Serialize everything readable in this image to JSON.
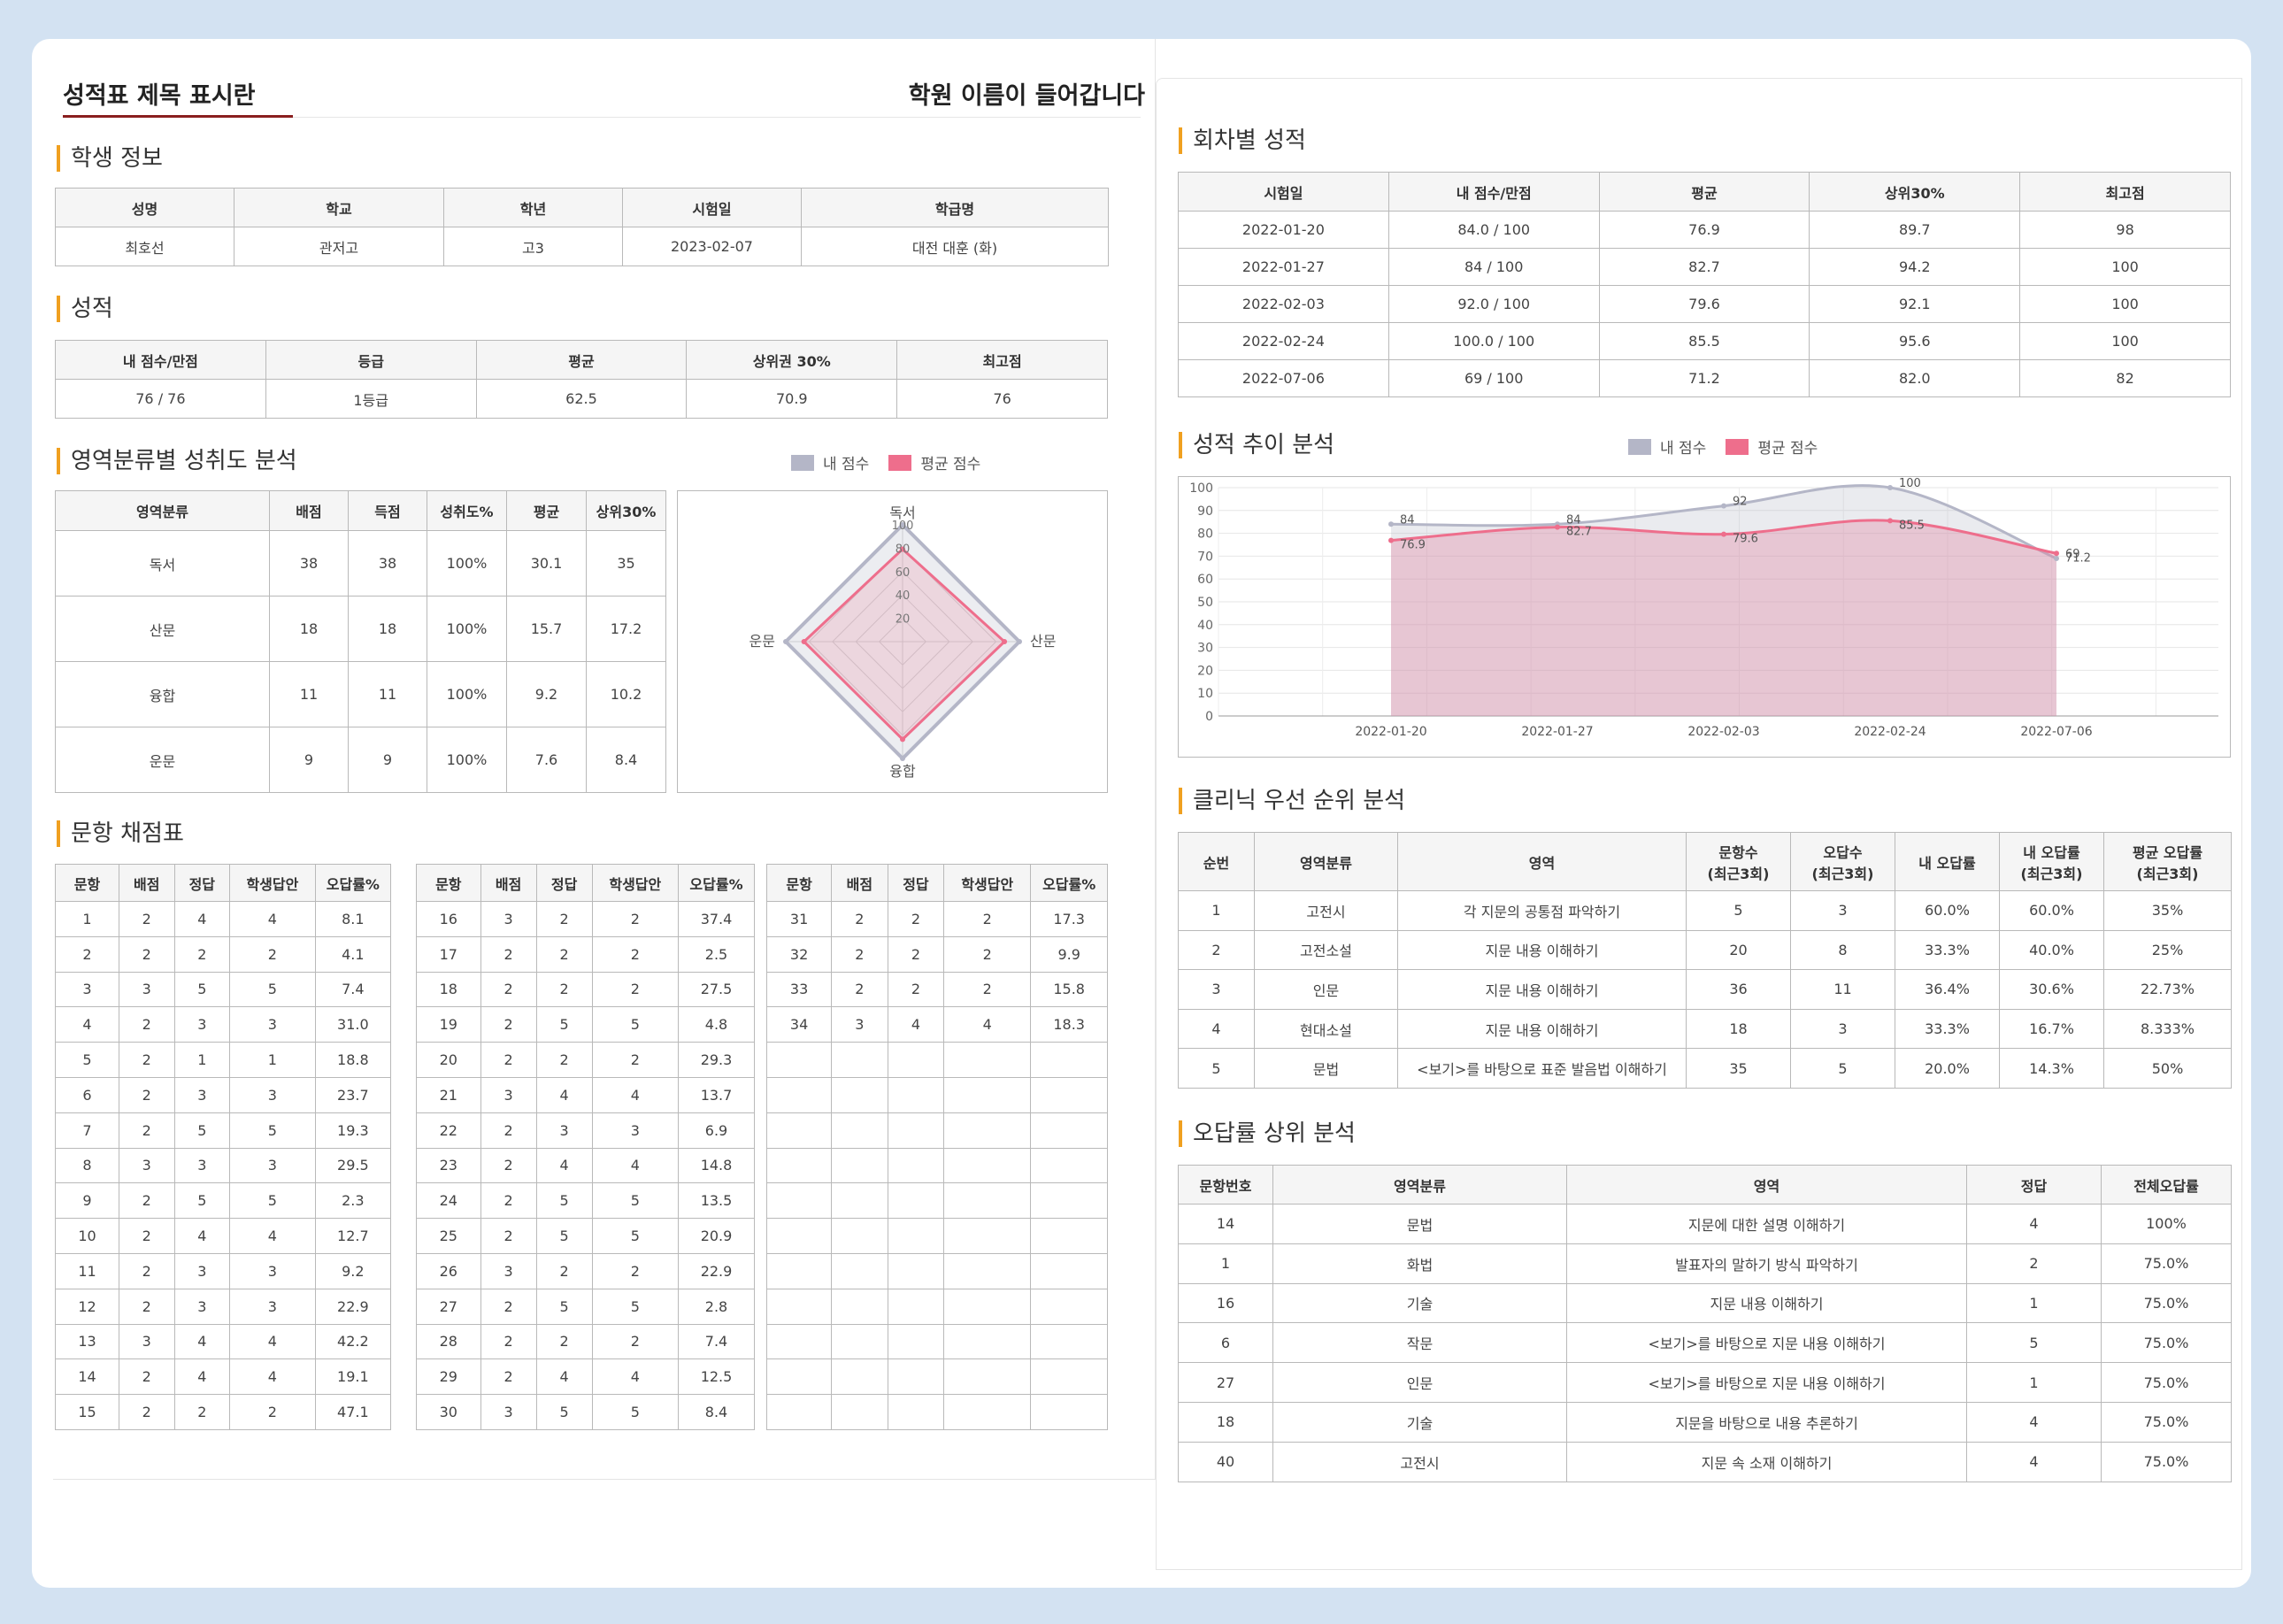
{
  "title": "성적표 제목 표시란",
  "academy": "학원 이름이 들어갑니다",
  "colors": {
    "accent": "#f0a020",
    "title_underline": "#8a1f1f",
    "my_score": "#b4b6c7",
    "avg_score": "#ee6e8c",
    "background": "#d3e2f2"
  },
  "student": {
    "section": "학생 정보",
    "headers": [
      "성명",
      "학교",
      "학년",
      "시험일",
      "학급명"
    ],
    "values": [
      "최호선",
      "관저고",
      "고3",
      "2023-02-07",
      "대전 대훈 (화)"
    ]
  },
  "score": {
    "section": "성적",
    "headers": [
      "내 점수/만점",
      "등급",
      "평균",
      "상위권 30%",
      "최고점"
    ],
    "values": [
      "76 / 76",
      "1등급",
      "62.5",
      "70.9",
      "76"
    ]
  },
  "area": {
    "section": "영역분류별 성취도 분석",
    "legend": [
      "내 점수",
      "평균 점수"
    ],
    "headers": [
      "영역분류",
      "배점",
      "득점",
      "성취도%",
      "평균",
      "상위30%"
    ],
    "rows": [
      [
        "독서",
        "38",
        "38",
        "100%",
        "30.1",
        "35"
      ],
      [
        "산문",
        "18",
        "18",
        "100%",
        "15.7",
        "17.2"
      ],
      [
        "융합",
        "11",
        "11",
        "100%",
        "9.2",
        "10.2"
      ],
      [
        "운문",
        "9",
        "9",
        "100%",
        "7.6",
        "8.4"
      ]
    ]
  },
  "radar": {
    "axes": [
      "독서",
      "산문",
      "융합",
      "운문"
    ],
    "ticks": [
      "20",
      "40",
      "60",
      "80",
      "100"
    ],
    "max": 100,
    "my": [
      100,
      100,
      100,
      100
    ],
    "avg": [
      79.2,
      87.2,
      83.6,
      84.4
    ]
  },
  "grading": {
    "section": "문항 채점표",
    "headers": [
      "문항",
      "배점",
      "정답",
      "학생답안",
      "오답률%"
    ],
    "blocks": [
      [
        [
          "1",
          "2",
          "4",
          "4",
          "8.1"
        ],
        [
          "2",
          "2",
          "2",
          "2",
          "4.1"
        ],
        [
          "3",
          "3",
          "5",
          "5",
          "7.4"
        ],
        [
          "4",
          "2",
          "3",
          "3",
          "31.0"
        ],
        [
          "5",
          "2",
          "1",
          "1",
          "18.8"
        ],
        [
          "6",
          "2",
          "3",
          "3",
          "23.7"
        ],
        [
          "7",
          "2",
          "5",
          "5",
          "19.3"
        ],
        [
          "8",
          "3",
          "3",
          "3",
          "29.5"
        ],
        [
          "9",
          "2",
          "5",
          "5",
          "2.3"
        ],
        [
          "10",
          "2",
          "4",
          "4",
          "12.7"
        ],
        [
          "11",
          "2",
          "3",
          "3",
          "9.2"
        ],
        [
          "12",
          "2",
          "3",
          "3",
          "22.9"
        ],
        [
          "13",
          "3",
          "4",
          "4",
          "42.2"
        ],
        [
          "14",
          "2",
          "4",
          "4",
          "19.1"
        ],
        [
          "15",
          "2",
          "2",
          "2",
          "47.1"
        ]
      ],
      [
        [
          "16",
          "3",
          "2",
          "2",
          "37.4"
        ],
        [
          "17",
          "2",
          "2",
          "2",
          "2.5"
        ],
        [
          "18",
          "2",
          "2",
          "2",
          "27.5"
        ],
        [
          "19",
          "2",
          "5",
          "5",
          "4.8"
        ],
        [
          "20",
          "2",
          "2",
          "2",
          "29.3"
        ],
        [
          "21",
          "3",
          "4",
          "4",
          "13.7"
        ],
        [
          "22",
          "2",
          "3",
          "3",
          "6.9"
        ],
        [
          "23",
          "2",
          "4",
          "4",
          "14.8"
        ],
        [
          "24",
          "2",
          "5",
          "5",
          "13.5"
        ],
        [
          "25",
          "2",
          "5",
          "5",
          "20.9"
        ],
        [
          "26",
          "3",
          "2",
          "2",
          "22.9"
        ],
        [
          "27",
          "2",
          "5",
          "5",
          "2.8"
        ],
        [
          "28",
          "2",
          "2",
          "2",
          "7.4"
        ],
        [
          "29",
          "2",
          "4",
          "4",
          "12.5"
        ],
        [
          "30",
          "3",
          "5",
          "5",
          "8.4"
        ]
      ],
      [
        [
          "31",
          "2",
          "2",
          "2",
          "17.3"
        ],
        [
          "32",
          "2",
          "2",
          "2",
          "9.9"
        ],
        [
          "33",
          "2",
          "2",
          "2",
          "15.8"
        ],
        [
          "34",
          "3",
          "4",
          "4",
          "18.3"
        ],
        [
          "",
          "",
          "",
          "",
          ""
        ],
        [
          "",
          "",
          "",
          "",
          ""
        ],
        [
          "",
          "",
          "",
          "",
          ""
        ],
        [
          "",
          "",
          "",
          "",
          ""
        ],
        [
          "",
          "",
          "",
          "",
          ""
        ],
        [
          "",
          "",
          "",
          "",
          ""
        ],
        [
          "",
          "",
          "",
          "",
          ""
        ],
        [
          "",
          "",
          "",
          "",
          ""
        ],
        [
          "",
          "",
          "",
          "",
          ""
        ],
        [
          "",
          "",
          "",
          "",
          ""
        ],
        [
          "",
          "",
          "",
          "",
          ""
        ]
      ]
    ]
  },
  "rounds": {
    "section": "회차별 성적",
    "headers": [
      "시험일",
      "내 점수/만점",
      "평균",
      "상위30%",
      "최고점"
    ],
    "rows": [
      [
        "2022-01-20",
        "84.0 / 100",
        "76.9",
        "89.7",
        "98"
      ],
      [
        "2022-01-27",
        "84 / 100",
        "82.7",
        "94.2",
        "100"
      ],
      [
        "2022-02-03",
        "92.0 / 100",
        "79.6",
        "92.1",
        "100"
      ],
      [
        "2022-02-24",
        "100.0 / 100",
        "85.5",
        "95.6",
        "100"
      ],
      [
        "2022-07-06",
        "69 / 100",
        "71.2",
        "82.0",
        "82"
      ]
    ]
  },
  "trend": {
    "section": "성적 추이 분석",
    "legend": [
      "내 점수",
      "평균 점수"
    ]
  },
  "chart_data": {
    "type": "area",
    "x": [
      "2022-01-20",
      "2022-01-27",
      "2022-02-03",
      "2022-02-24",
      "2022-07-06"
    ],
    "series": [
      {
        "name": "내 점수",
        "values": [
          84,
          84,
          92,
          100,
          69
        ]
      },
      {
        "name": "평균 점수",
        "values": [
          76.9,
          82.7,
          79.6,
          85.5,
          71.2
        ]
      }
    ],
    "point_labels": [
      [
        "84",
        "84",
        "92",
        "100",
        "69"
      ],
      [
        "76.9",
        "82.7",
        "79.6",
        "85.5",
        "71.2"
      ]
    ],
    "ylim": [
      0,
      100
    ],
    "yticks": [
      "0",
      "10",
      "20",
      "30",
      "40",
      "50",
      "60",
      "70",
      "80",
      "90",
      "100"
    ],
    "grid": true,
    "legend_position": "top"
  },
  "clinic": {
    "section": "클리닉 우선 순위 분석",
    "headers": [
      "순번",
      "영역분류",
      "영역",
      "문항수\n(최근3회)",
      "오답수\n(최근3회)",
      "내 오답률",
      "내 오답률\n(최근3회)",
      "평균 오답률\n(최근3회)"
    ],
    "rows": [
      [
        "1",
        "고전시",
        "각 지문의 공통점 파악하기",
        "5",
        "3",
        "60.0%",
        "60.0%",
        "35%"
      ],
      [
        "2",
        "고전소설",
        "지문 내용 이해하기",
        "20",
        "8",
        "33.3%",
        "40.0%",
        "25%"
      ],
      [
        "3",
        "인문",
        "지문 내용 이해하기",
        "36",
        "11",
        "36.4%",
        "30.6%",
        "22.73%"
      ],
      [
        "4",
        "현대소설",
        "지문 내용 이해하기",
        "18",
        "3",
        "33.3%",
        "16.7%",
        "8.333%"
      ],
      [
        "5",
        "문법",
        "<보기>를 바탕으로 표준 발음법 이해하기",
        "35",
        "5",
        "20.0%",
        "14.3%",
        "50%"
      ]
    ]
  },
  "wrong": {
    "section": "오답률 상위 분석",
    "headers": [
      "문항번호",
      "영역분류",
      "영역",
      "정답",
      "전체오답률"
    ],
    "rows": [
      [
        "14",
        "문법",
        "지문에 대한 설명 이해하기",
        "4",
        "100%"
      ],
      [
        "1",
        "화법",
        "발표자의 말하기 방식 파악하기",
        "2",
        "75.0%"
      ],
      [
        "16",
        "기술",
        "지문 내용 이해하기",
        "1",
        "75.0%"
      ],
      [
        "6",
        "작문",
        "<보기>를 바탕으로 지문 내용 이해하기",
        "5",
        "75.0%"
      ],
      [
        "27",
        "인문",
        "<보기>를 바탕으로 지문 내용 이해하기",
        "1",
        "75.0%"
      ],
      [
        "18",
        "기술",
        "지문을 바탕으로 내용 추론하기",
        "4",
        "75.0%"
      ],
      [
        "40",
        "고전시",
        "지문 속 소재 이해하기",
        "4",
        "75.0%"
      ]
    ]
  }
}
